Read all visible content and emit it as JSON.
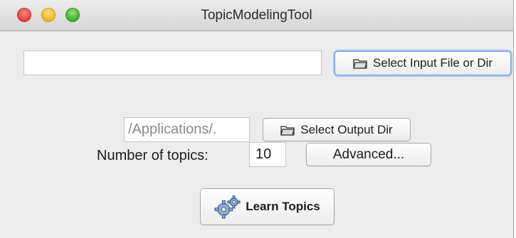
{
  "window": {
    "title": "TopicModelingTool",
    "controls": [
      "close",
      "minimize",
      "zoom"
    ]
  },
  "input": {
    "value": "",
    "button_label": "Select Input File or Dir",
    "button_icon": "folder-icon"
  },
  "output": {
    "value": "/Applications/.",
    "button_label": "Select Output Dir",
    "button_icon": "folder-icon"
  },
  "topics": {
    "label": "Number of topics:",
    "value": "10",
    "advanced_label": "Advanced..."
  },
  "learn": {
    "label": "Learn Topics",
    "icon": "gears-icon"
  }
}
